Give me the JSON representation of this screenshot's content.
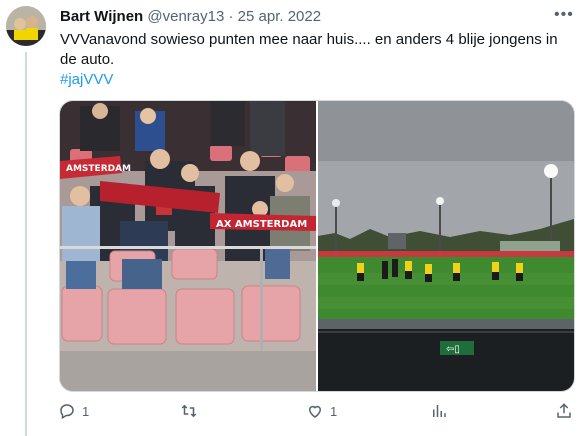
{
  "tweet": {
    "author_name": "Bart Wijnen",
    "handle": "@venray13",
    "separator": "·",
    "date": "25 apr. 2022",
    "more_icon": "more-dots-icon",
    "text": "VVVanavond sowieso punten mee naar huis.... en anders 4 blije jongens in de auto.",
    "hashtag": "#jajVVV"
  },
  "media": {
    "left_photo_scarf_text_1": "AMSTERDAM",
    "left_photo_scarf_text_2": "AX AMSTERDAM"
  },
  "actions": {
    "reply_count": "1",
    "retweet_count": "",
    "like_count": "1",
    "icons": [
      "reply-icon",
      "retweet-icon",
      "like-icon",
      "views-icon",
      "share-icon"
    ]
  },
  "colors": {
    "link": "#1d9bf0",
    "muted": "#536471",
    "border": "#cfd9de"
  }
}
